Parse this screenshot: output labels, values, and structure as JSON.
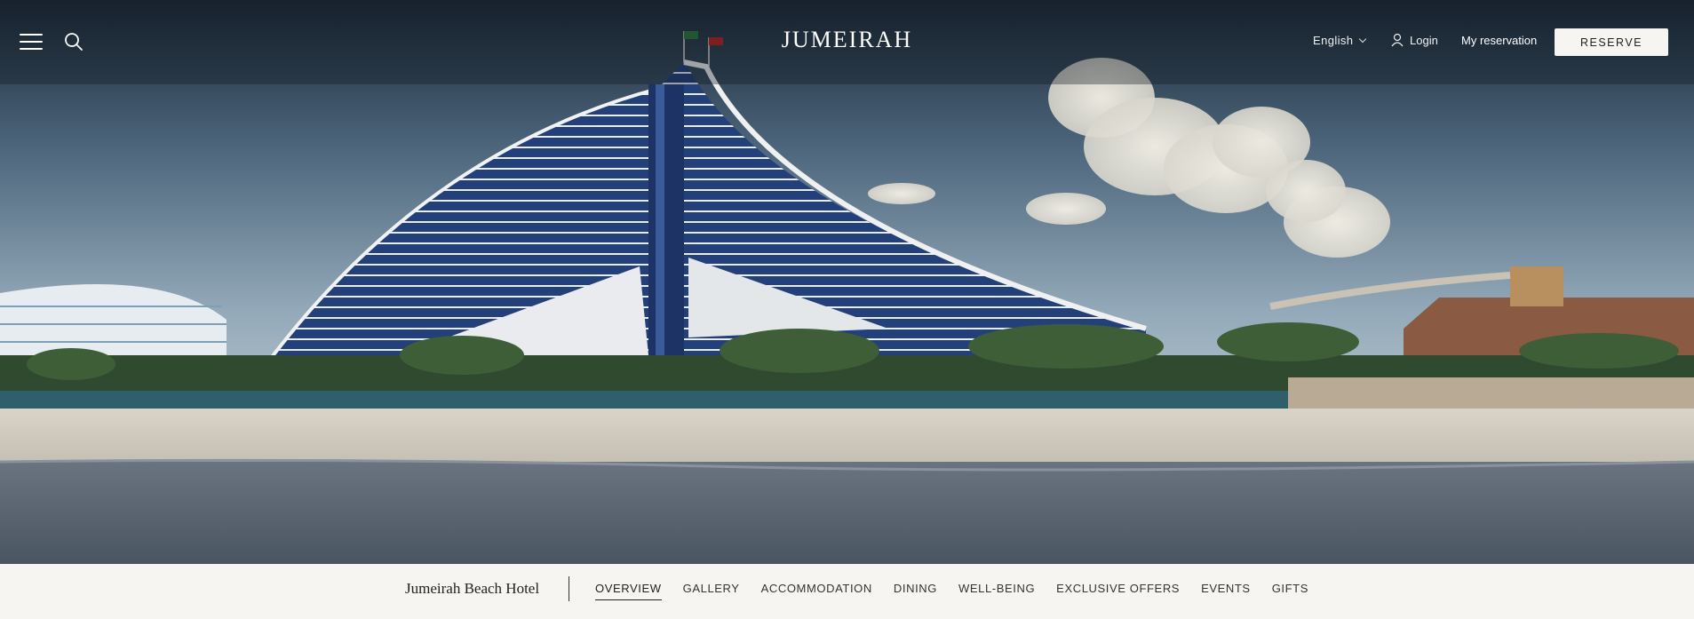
{
  "header": {
    "logo": "JUMEIRAH",
    "language": "English",
    "login_label": "Login",
    "my_reservation_label": "My reservation",
    "reserve_label": "RESERVE"
  },
  "hero": {
    "image_subject": "hotel-beach-scene"
  },
  "subnav": {
    "hotel_name": "Jumeirah Beach Hotel",
    "tabs": [
      {
        "label": "OVERVIEW",
        "active": true
      },
      {
        "label": "GALLERY",
        "active": false
      },
      {
        "label": "ACCOMMODATION",
        "active": false
      },
      {
        "label": "DINING",
        "active": false
      },
      {
        "label": "WELL-BEING",
        "active": false
      },
      {
        "label": "EXCLUSIVE OFFERS",
        "active": false
      },
      {
        "label": "EVENTS",
        "active": false
      },
      {
        "label": "GIFTS",
        "active": false
      }
    ]
  },
  "colors": {
    "sky_top": "#1f2d3a",
    "sky_bottom": "#b9c6cf",
    "building_blue": "#243f78",
    "sand": "#d4cec4",
    "sea": "#56626f",
    "nav_bg": "#f6f5f1"
  }
}
